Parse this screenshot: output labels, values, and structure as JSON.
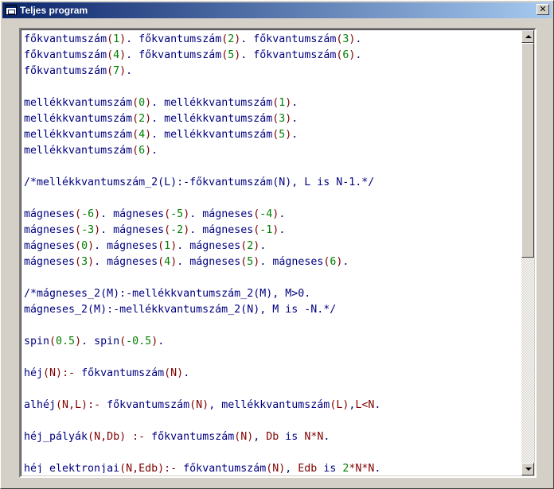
{
  "window": {
    "title": "Teljes program",
    "close_label": "✕"
  },
  "colors": {
    "identifier": "#000080",
    "paren": "#800000",
    "number": "#008000",
    "operator": "#800000"
  },
  "lines": [
    [
      [
        "p",
        "főkvantumszám"
      ],
      [
        "b",
        "("
      ],
      [
        "n",
        "1"
      ],
      [
        "b",
        ")"
      ],
      [
        "t",
        ". "
      ],
      [
        "p",
        "főkvantumszám"
      ],
      [
        "b",
        "("
      ],
      [
        "n",
        "2"
      ],
      [
        "b",
        ")"
      ],
      [
        "t",
        ". "
      ],
      [
        "p",
        "főkvantumszám"
      ],
      [
        "b",
        "("
      ],
      [
        "n",
        "3"
      ],
      [
        "b",
        ")"
      ],
      [
        "t",
        "."
      ]
    ],
    [
      [
        "p",
        "főkvantumszám"
      ],
      [
        "b",
        "("
      ],
      [
        "n",
        "4"
      ],
      [
        "b",
        ")"
      ],
      [
        "t",
        ". "
      ],
      [
        "p",
        "főkvantumszám"
      ],
      [
        "b",
        "("
      ],
      [
        "n",
        "5"
      ],
      [
        "b",
        ")"
      ],
      [
        "t",
        ". "
      ],
      [
        "p",
        "főkvantumszám"
      ],
      [
        "b",
        "("
      ],
      [
        "n",
        "6"
      ],
      [
        "b",
        ")"
      ],
      [
        "t",
        "."
      ]
    ],
    [
      [
        "p",
        "főkvantumszám"
      ],
      [
        "b",
        "("
      ],
      [
        "n",
        "7"
      ],
      [
        "b",
        ")"
      ],
      [
        "t",
        "."
      ]
    ],
    [],
    [
      [
        "p",
        "mellékkvantumszám"
      ],
      [
        "b",
        "("
      ],
      [
        "n",
        "0"
      ],
      [
        "b",
        ")"
      ],
      [
        "t",
        ". "
      ],
      [
        "p",
        "mellékkvantumszám"
      ],
      [
        "b",
        "("
      ],
      [
        "n",
        "1"
      ],
      [
        "b",
        ")"
      ],
      [
        "t",
        "."
      ]
    ],
    [
      [
        "p",
        "mellékkvantumszám"
      ],
      [
        "b",
        "("
      ],
      [
        "n",
        "2"
      ],
      [
        "b",
        ")"
      ],
      [
        "t",
        ". "
      ],
      [
        "p",
        "mellékkvantumszám"
      ],
      [
        "b",
        "("
      ],
      [
        "n",
        "3"
      ],
      [
        "b",
        ")"
      ],
      [
        "t",
        "."
      ]
    ],
    [
      [
        "p",
        "mellékkvantumszám"
      ],
      [
        "b",
        "("
      ],
      [
        "n",
        "4"
      ],
      [
        "b",
        ")"
      ],
      [
        "t",
        ". "
      ],
      [
        "p",
        "mellékkvantumszám"
      ],
      [
        "b",
        "("
      ],
      [
        "n",
        "5"
      ],
      [
        "b",
        ")"
      ],
      [
        "t",
        "."
      ]
    ],
    [
      [
        "p",
        "mellékkvantumszám"
      ],
      [
        "b",
        "("
      ],
      [
        "n",
        "6"
      ],
      [
        "b",
        ")"
      ],
      [
        "t",
        "."
      ]
    ],
    [],
    [
      [
        "t",
        "/*mellékkvantumszám_2(L):-főkvantumszám(N), L is N-1.*/"
      ]
    ],
    [],
    [
      [
        "p",
        "mágneses"
      ],
      [
        "b",
        "("
      ],
      [
        "n",
        "-6"
      ],
      [
        "b",
        ")"
      ],
      [
        "t",
        ". "
      ],
      [
        "p",
        "mágneses"
      ],
      [
        "b",
        "("
      ],
      [
        "n",
        "-5"
      ],
      [
        "b",
        ")"
      ],
      [
        "t",
        ". "
      ],
      [
        "p",
        "mágneses"
      ],
      [
        "b",
        "("
      ],
      [
        "n",
        "-4"
      ],
      [
        "b",
        ")"
      ],
      [
        "t",
        "."
      ]
    ],
    [
      [
        "p",
        "mágneses"
      ],
      [
        "b",
        "("
      ],
      [
        "n",
        "-3"
      ],
      [
        "b",
        ")"
      ],
      [
        "t",
        ". "
      ],
      [
        "p",
        "mágneses"
      ],
      [
        "b",
        "("
      ],
      [
        "n",
        "-2"
      ],
      [
        "b",
        ")"
      ],
      [
        "t",
        ". "
      ],
      [
        "p",
        "mágneses"
      ],
      [
        "b",
        "("
      ],
      [
        "n",
        "-1"
      ],
      [
        "b",
        ")"
      ],
      [
        "t",
        "."
      ]
    ],
    [
      [
        "p",
        "mágneses"
      ],
      [
        "b",
        "("
      ],
      [
        "n",
        "0"
      ],
      [
        "b",
        ")"
      ],
      [
        "t",
        ". "
      ],
      [
        "p",
        "mágneses"
      ],
      [
        "b",
        "("
      ],
      [
        "n",
        "1"
      ],
      [
        "b",
        ")"
      ],
      [
        "t",
        ". "
      ],
      [
        "p",
        "mágneses"
      ],
      [
        "b",
        "("
      ],
      [
        "n",
        "2"
      ],
      [
        "b",
        ")"
      ],
      [
        "t",
        "."
      ]
    ],
    [
      [
        "p",
        "mágneses"
      ],
      [
        "b",
        "("
      ],
      [
        "n",
        "3"
      ],
      [
        "b",
        ")"
      ],
      [
        "t",
        ". "
      ],
      [
        "p",
        "mágneses"
      ],
      [
        "b",
        "("
      ],
      [
        "n",
        "4"
      ],
      [
        "b",
        ")"
      ],
      [
        "t",
        ". "
      ],
      [
        "p",
        "mágneses"
      ],
      [
        "b",
        "("
      ],
      [
        "n",
        "5"
      ],
      [
        "b",
        ")"
      ],
      [
        "t",
        ". "
      ],
      [
        "p",
        "mágneses"
      ],
      [
        "b",
        "("
      ],
      [
        "n",
        "6"
      ],
      [
        "b",
        ")"
      ],
      [
        "t",
        "."
      ]
    ],
    [],
    [
      [
        "t",
        "/*mágneses_2(M):-mellékkvantumszám_2(M), M>0."
      ]
    ],
    [
      [
        "t",
        "mágneses_2(M):-mellékkvantumszám_2(N), M is -N.*/"
      ]
    ],
    [],
    [
      [
        "p",
        "spin"
      ],
      [
        "b",
        "("
      ],
      [
        "n",
        "0.5"
      ],
      [
        "b",
        ")"
      ],
      [
        "t",
        ". "
      ],
      [
        "p",
        "spin"
      ],
      [
        "b",
        "("
      ],
      [
        "n",
        "-0.5"
      ],
      [
        "b",
        ")"
      ],
      [
        "t",
        "."
      ]
    ],
    [],
    [
      [
        "p",
        "héj"
      ],
      [
        "b",
        "(N)"
      ],
      [
        "o",
        ":-"
      ],
      [
        "t",
        " "
      ],
      [
        "p",
        "főkvantumszám"
      ],
      [
        "b",
        "(N)"
      ],
      [
        "t",
        "."
      ]
    ],
    [],
    [
      [
        "p",
        "alhéj"
      ],
      [
        "b",
        "(N,L)"
      ],
      [
        "o",
        ":-"
      ],
      [
        "t",
        " "
      ],
      [
        "p",
        "főkvantumszám"
      ],
      [
        "b",
        "(N)"
      ],
      [
        "t",
        ", "
      ],
      [
        "p",
        "mellékkvantumszám"
      ],
      [
        "b",
        "(L)"
      ],
      [
        "t",
        ","
      ],
      [
        "b",
        "L<N"
      ],
      [
        "t",
        "."
      ]
    ],
    [],
    [
      [
        "p",
        "héj_pályák"
      ],
      [
        "b",
        "(N,Db)"
      ],
      [
        "t",
        " "
      ],
      [
        "o",
        ":-"
      ],
      [
        "t",
        " "
      ],
      [
        "p",
        "főkvantumszám"
      ],
      [
        "b",
        "(N)"
      ],
      [
        "t",
        ", "
      ],
      [
        "b",
        "Db"
      ],
      [
        "t",
        " is "
      ],
      [
        "b",
        "N*N"
      ],
      [
        "t",
        "."
      ]
    ],
    [],
    [
      [
        "p",
        "héj_elektronjai"
      ],
      [
        "b",
        "(N,Edb)"
      ],
      [
        "o",
        ":-"
      ],
      [
        "t",
        " "
      ],
      [
        "p",
        "főkvantumszám"
      ],
      [
        "b",
        "(N)"
      ],
      [
        "t",
        ", "
      ],
      [
        "b",
        "Edb"
      ],
      [
        "t",
        " is "
      ],
      [
        "n",
        "2"
      ],
      [
        "b",
        "*N*N"
      ],
      [
        "t",
        "."
      ]
    ]
  ]
}
